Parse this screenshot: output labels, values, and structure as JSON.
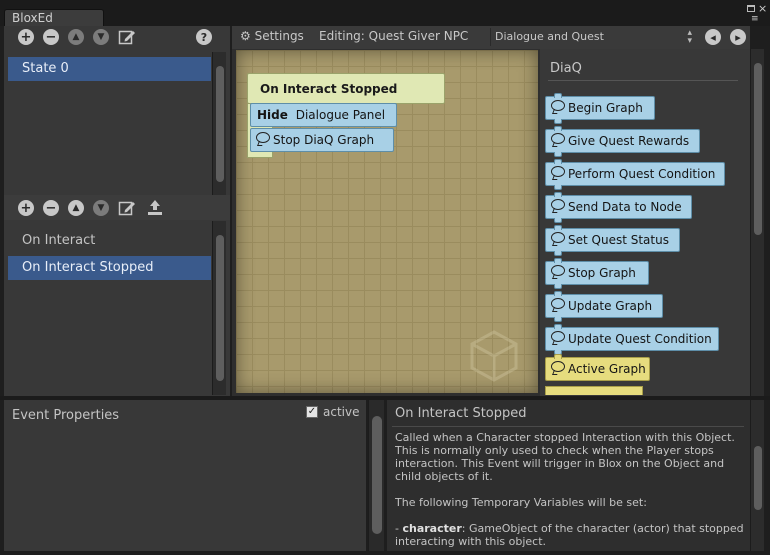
{
  "window": {
    "tab_title": "BloxEd"
  },
  "toolbar": {
    "settings_label": "Settings",
    "editing_label": "Editing: Quest Giver NPC",
    "category_select": "Dialogue and Quest"
  },
  "states": {
    "items": [
      {
        "label": "State 0",
        "selected": true
      }
    ]
  },
  "events": {
    "items": [
      {
        "label": "On Interact",
        "selected": false
      },
      {
        "label": "On Interact Stopped",
        "selected": true
      }
    ]
  },
  "canvas": {
    "event_block_title": "On Interact Stopped",
    "blocks": [
      {
        "keyword": "Hide",
        "label": "Dialogue Panel"
      },
      {
        "keyword": "",
        "label": "Stop DiaQ Graph"
      }
    ]
  },
  "palette": {
    "heading": "DiaQ",
    "items": [
      {
        "label": "Begin Graph",
        "color": "blue"
      },
      {
        "label": "Give Quest Rewards",
        "color": "blue"
      },
      {
        "label": "Perform Quest Condition",
        "color": "blue"
      },
      {
        "label": "Send Data to Node",
        "color": "blue"
      },
      {
        "label": "Set Quest Status",
        "color": "blue"
      },
      {
        "label": "Stop Graph",
        "color": "blue"
      },
      {
        "label": "Update Graph",
        "color": "blue"
      },
      {
        "label": "Update Quest Condition",
        "color": "blue"
      },
      {
        "label": "Active Graph",
        "color": "yellow"
      }
    ]
  },
  "event_properties": {
    "title": "Event Properties",
    "active_label": "active",
    "active_checked": true
  },
  "help": {
    "title": "On Interact Stopped",
    "paragraph1": "Called when a Character stopped Interaction with this Object. This is normally only used to check when the Player stops interaction. This Event will trigger in Blox on the Object and child objects of it.",
    "paragraph2": "The following Temporary Variables will be set:",
    "var_name": "character",
    "var_desc": ": GameObject of the character (actor) that stopped interacting with this object."
  },
  "colors": {
    "selection": "#3a5a8c",
    "canvas": "#a89a6c",
    "node_blue": "#a8d0e6",
    "node_yellow": "#e6dc7e"
  }
}
